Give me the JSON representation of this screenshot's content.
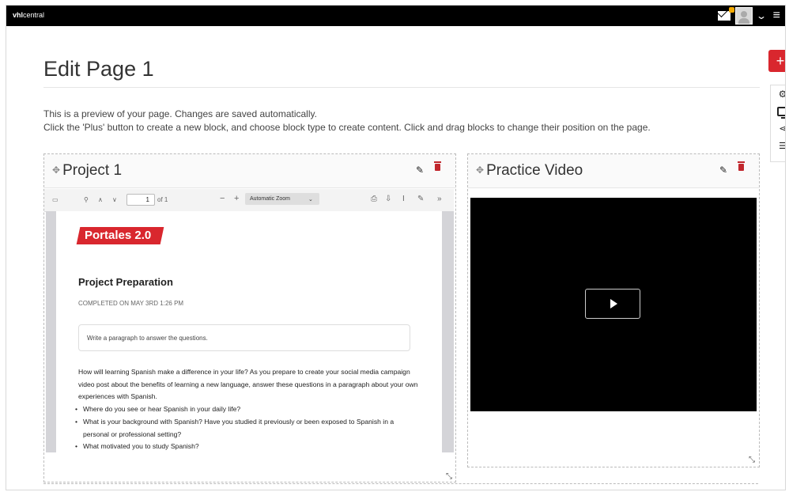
{
  "app": {
    "brand_bold": "vhl",
    "brand_rest": "central"
  },
  "header": {
    "title": "Edit Page 1",
    "description_line1": "This is a preview of your page. Changes are saved automatically.",
    "description_line2": "Click the 'Plus' button to create a new block, and choose block type to create content. Click and drag blocks to change their position on the page."
  },
  "side_toolbar": {
    "add_label": "+",
    "icons": [
      "gear-icon",
      "monitor-icon",
      "share-icon",
      "layers-icon"
    ]
  },
  "blocks": [
    {
      "title": "Project 1",
      "type": "pdf",
      "pdf_viewer": {
        "page_number": "1",
        "page_count": "of 1",
        "zoom": "Automatic Zoom"
      },
      "pdf_content": {
        "logo": "Portales 2.0",
        "heading": "Project Preparation",
        "completed": "COMPLETED ON MAY 3RD 1:26 PM",
        "answer_placeholder": "Write a paragraph to answer the questions.",
        "paragraph": "How will learning Spanish make a difference in your life? As you prepare to create your social media campaign video post about the benefits of learning a new language, answer these questions in a paragraph about your own experiences with Spanish.",
        "bullets": [
          "Where do you see or hear Spanish in your daily life?",
          "What is your background with Spanish? Have you studied it previously or been exposed to Spanish in a personal or professional setting?",
          "What motivated you to study Spanish?"
        ]
      }
    },
    {
      "title": "Practice Video",
      "type": "video"
    }
  ],
  "colors": {
    "topbar": "#000000",
    "accent_red": "#d9272e",
    "badge": "#f2a900"
  }
}
